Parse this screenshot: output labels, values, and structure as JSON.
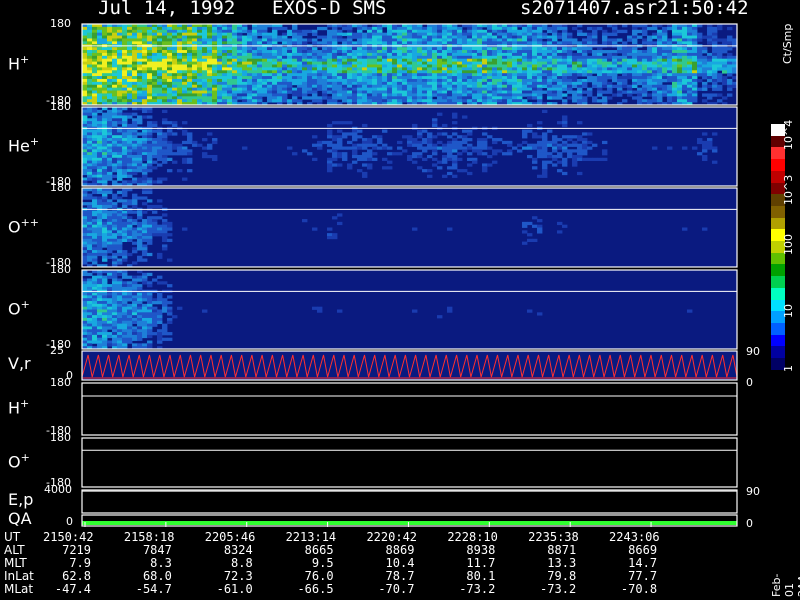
{
  "header": {
    "date": "Jul 14, 1992",
    "instrument": "EXOS-D SMS",
    "file": "s2071407.asr",
    "time": "21:50:42"
  },
  "chart_data": {
    "type": "heatmap",
    "panels": [
      {
        "label": "H",
        "sup": "+",
        "kind": "spectrogram",
        "ymax": "180",
        "ymin": "-180",
        "intensity_profile": [
          0.95,
          0.9,
          0.92,
          0.88,
          0.9,
          0.85,
          0.7,
          0.6,
          0.55,
          0.5,
          0.45,
          0.5,
          0.55,
          0.6,
          0.62,
          0.6,
          0.58,
          0.6,
          0.62,
          0.6,
          0.55,
          0.5,
          0.45,
          0.42,
          0.4,
          0.45,
          0.5,
          0.6,
          0.4,
          0.35
        ]
      },
      {
        "label": "He",
        "sup": "+",
        "kind": "spectrogram",
        "ymin": "-180",
        "ymax": "180",
        "intensity_profile": [
          0.55,
          0.5,
          0.45,
          0.35,
          0.3,
          0.25,
          0.2,
          0.2,
          0.2,
          0.22,
          0.25,
          0.3,
          0.3,
          0.28,
          0.25,
          0.3,
          0.32,
          0.3,
          0.28,
          0.25,
          0.3,
          0.32,
          0.3,
          0.25,
          0.2,
          0.2,
          0.2,
          0.2,
          0.25,
          0.2
        ]
      },
      {
        "label": "O",
        "sup": "++",
        "kind": "spectrogram",
        "ymin": "-180",
        "ymax": "180",
        "intensity_profile": [
          0.5,
          0.45,
          0.4,
          0.3,
          0.2,
          0.18,
          0.18,
          0.18,
          0.18,
          0.2,
          0.22,
          0.25,
          0.2,
          0.18,
          0.18,
          0.2,
          0.2,
          0.18,
          0.18,
          0.2,
          0.25,
          0.22,
          0.2,
          0.18,
          0.18,
          0.18,
          0.18,
          0.2,
          0.2,
          0.18
        ]
      },
      {
        "label": "O",
        "sup": "+",
        "kind": "spectrogram",
        "ymin": "-180",
        "ymax": "180",
        "intensity_profile": [
          0.55,
          0.5,
          0.45,
          0.35,
          0.22,
          0.2,
          0.18,
          0.18,
          0.18,
          0.2,
          0.22,
          0.2,
          0.2,
          0.18,
          0.18,
          0.2,
          0.22,
          0.2,
          0.18,
          0.2,
          0.22,
          0.2,
          0.18,
          0.18,
          0.18,
          0.18,
          0.18,
          0.2,
          0.2,
          0.18
        ]
      },
      {
        "label": "V,r",
        "kind": "line",
        "ymax": "25",
        "ymin": "0",
        "right_ticks": [
          "90",
          "0"
        ]
      },
      {
        "label": "H",
        "sup": "+",
        "kind": "flat",
        "ymax": "180",
        "ymin": "-180"
      },
      {
        "label": "O",
        "sup": "+",
        "kind": "flat",
        "ymax": "180",
        "ymin": "-180"
      },
      {
        "label": "E,p",
        "kind": "flat",
        "ymax": "4000",
        "right_ticks": [
          "90"
        ]
      },
      {
        "label": "QA",
        "kind": "qa",
        "ymin": "0",
        "right_ticks": [
          "0"
        ]
      }
    ],
    "x_ticks": [
      "2150:42",
      "2158:18",
      "2205:46",
      "2213:14",
      "2220:42",
      "2228:10",
      "2235:38",
      "2243:06"
    ],
    "colorbar": {
      "title": "Ct/Smp",
      "labels": [
        "1",
        "10",
        "100",
        "10^3",
        "10^4"
      ],
      "colors": [
        "#000064",
        "#0000a0",
        "#0000ff",
        "#0060ff",
        "#00a0ff",
        "#00e0ff",
        "#00ffc0",
        "#00d050",
        "#00a000",
        "#60c000",
        "#c0d000",
        "#ffff00",
        "#b0a000",
        "#806000",
        "#604000",
        "#800000",
        "#c00000",
        "#ff0000",
        "#ff3030",
        "#600000",
        "#ffffff"
      ]
    }
  },
  "ephemeris": {
    "rows": [
      {
        "name": "UT",
        "values": [
          "2150:42",
          "2158:18",
          "2205:46",
          "2213:14",
          "2220:42",
          "2228:10",
          "2235:38",
          "2243:06"
        ]
      },
      {
        "name": "ALT",
        "values": [
          "7219",
          "7847",
          "8324",
          "8665",
          "8869",
          "8938",
          "8871",
          "8669"
        ]
      },
      {
        "name": "MLT",
        "values": [
          "7.9",
          "8.3",
          "8.8",
          "9.5",
          "10.4",
          "11.7",
          "13.3",
          "14.7"
        ]
      },
      {
        "name": "InLat",
        "values": [
          "62.8",
          "68.0",
          "72.3",
          "76.0",
          "78.7",
          "80.1",
          "79.8",
          "77.7"
        ]
      },
      {
        "name": "MLat",
        "values": [
          "-47.4",
          "-54.7",
          "-61.0",
          "-66.5",
          "-70.7",
          "-73.2",
          "-73.2",
          "-70.8"
        ]
      }
    ]
  },
  "footnote": "Feb-01 2AA"
}
